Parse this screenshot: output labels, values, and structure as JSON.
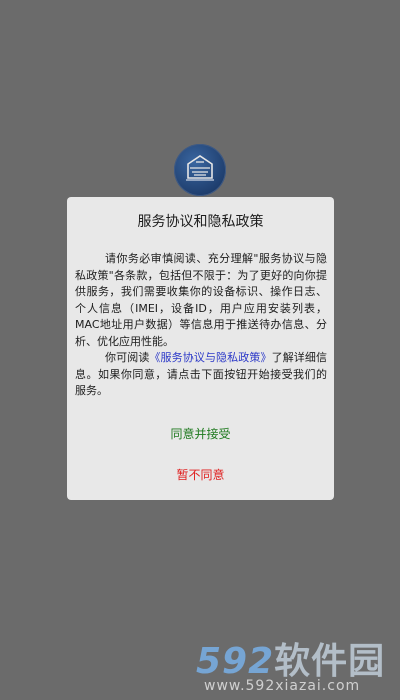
{
  "logo": {
    "icon": "app-logo-icon",
    "colors": {
      "bg": "#1f3f6f",
      "fg": "#e6e6e6"
    }
  },
  "dialog": {
    "title": "服务协议和隐私政策",
    "paragraph1": "请你务必审慎阅读、充分理解\"服务协议与隐私政策\"各条款，包括但不限于：为了更好的向你提供服务，我们需要收集你的设备标识、操作日志、个人信息（IMEI，设备ID，用户应用安装列表，MAC地址用户数据）等信息用于推送待办信息、分析、优化应用性能。",
    "paragraph2_prefix": "你可阅读",
    "paragraph2_link": "《服务协议与隐私政策》",
    "paragraph2_suffix": "了解详细信息。如果你同意，请点击下面按钮开始接受我们的服务。",
    "agree_label": "同意并接受",
    "disagree_label": "暂不同意",
    "colors": {
      "link": "#2b38c8",
      "agree": "#1f7a1f",
      "disagree": "#e02020",
      "background": "#e8e8e8"
    }
  },
  "watermark": {
    "number": "592",
    "brand": "软件园",
    "url": "www.592xiazai.com"
  }
}
